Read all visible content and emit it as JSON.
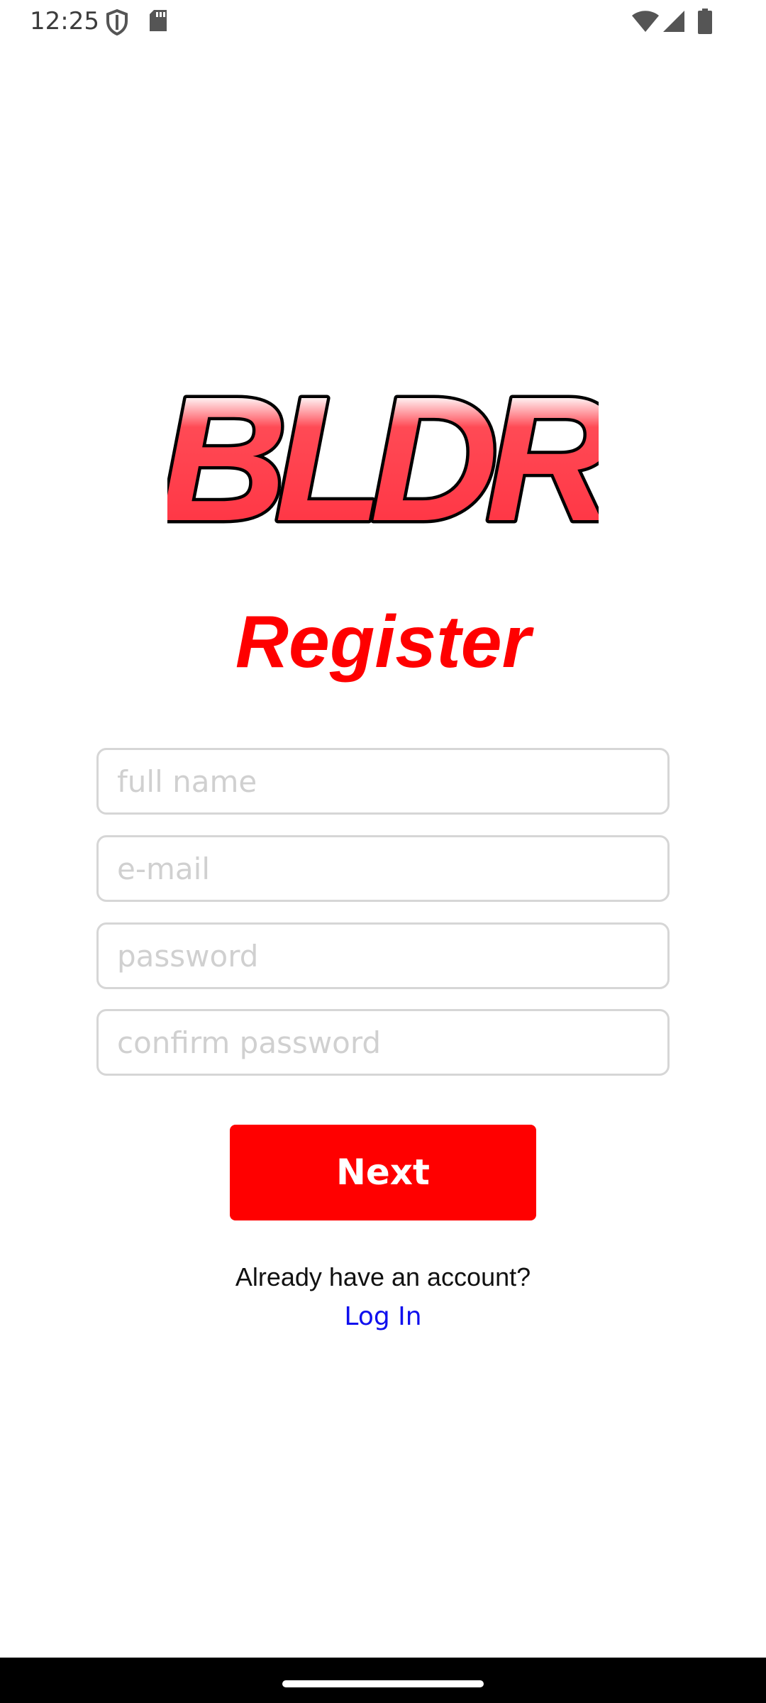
{
  "status_bar": {
    "time": "12:25",
    "icons_left": [
      "shield-icon",
      "sd-card-icon"
    ],
    "icons_right": [
      "wifi-icon",
      "cell-signal-icon",
      "battery-icon"
    ]
  },
  "logo": {
    "text": "BLDR",
    "fill_color": "#ff3040",
    "outline_color": "#000000"
  },
  "title": "Register",
  "form": {
    "full_name": {
      "placeholder": "full name",
      "value": ""
    },
    "email": {
      "placeholder": "e-mail",
      "value": ""
    },
    "password": {
      "placeholder": "password",
      "value": ""
    },
    "confirm_password": {
      "placeholder": "confirm password",
      "value": ""
    }
  },
  "next_button": "Next",
  "account_prompt": "Already have an account?",
  "login_link": "Log In",
  "colors": {
    "accent": "#ff0000",
    "link": "#1010ee",
    "field_border": "#d6d6d6"
  }
}
